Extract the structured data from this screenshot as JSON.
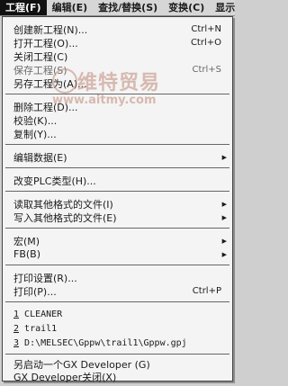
{
  "menubar": [
    {
      "label": "工程(F)",
      "active": true
    },
    {
      "label": "编辑(E)"
    },
    {
      "label": "查找/替换(S)"
    },
    {
      "label": "变换(C)"
    },
    {
      "label": "显示"
    }
  ],
  "menu": {
    "new_project": {
      "label": "创建新工程(N)...",
      "shortcut": "Ctrl+N"
    },
    "open_project": {
      "label": "打开工程(O)...",
      "shortcut": "Ctrl+O"
    },
    "close_project": {
      "label": "关闭工程(C)"
    },
    "save_project": {
      "label": "保存工程(S)",
      "shortcut": "Ctrl+S"
    },
    "save_as": {
      "label": "另存工程为(A)..."
    },
    "delete_project": {
      "label": "删除工程(D)..."
    },
    "verify": {
      "label": "校验(K)..."
    },
    "copy": {
      "label": "复制(Y)..."
    },
    "edit_data": {
      "label": "编辑数据(E)"
    },
    "change_plc": {
      "label": "改变PLC类型(H)..."
    },
    "read_other": {
      "label": "读取其他格式的文件(I)"
    },
    "write_other": {
      "label": "写入其他格式的文件(E)"
    },
    "macro": {
      "label": "宏(M)"
    },
    "fb": {
      "label": "FB(B)"
    },
    "print_setup": {
      "label": "打印设置(R)..."
    },
    "print": {
      "label": "打印(P)...",
      "shortcut": "Ctrl+P"
    },
    "recent": [
      "1 CLEANER",
      "2 trail1",
      "3 D:\\MELSEC\\Gppw\\trail1\\Gppw.gpj"
    ],
    "start_another": {
      "label": "另启动一个GX Developer (G)"
    },
    "exit": {
      "label": "GX Developer关闭(X)"
    }
  },
  "watermark": {
    "text": "维特贸易",
    "url": "www.aitmy.com"
  }
}
